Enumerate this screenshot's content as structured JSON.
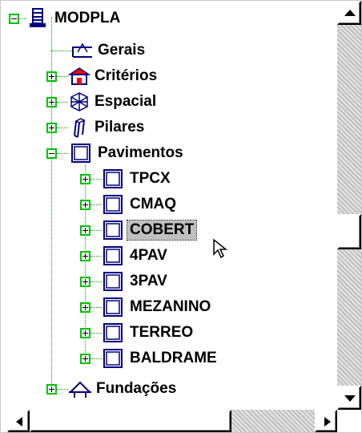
{
  "tree": {
    "nodes": [
      {
        "id": "root",
        "label": "MODPLA",
        "icon": "building-icon",
        "expander": "minus"
      },
      {
        "id": "gerais",
        "label": "Gerais",
        "icon": "beam-icon",
        "expander": "none"
      },
      {
        "id": "criterios",
        "label": "Critérios",
        "icon": "criteria-icon",
        "expander": "plus"
      },
      {
        "id": "espacial",
        "label": "Espacial",
        "icon": "spatial-frame-icon",
        "expander": "plus"
      },
      {
        "id": "pilares",
        "label": "Pilares",
        "icon": "column-icon",
        "expander": "plus"
      },
      {
        "id": "pavimentos",
        "label": "Pavimentos",
        "icon": "floor-icon",
        "expander": "minus"
      },
      {
        "id": "tpcx",
        "label": "TPCX",
        "icon": "floor-icon",
        "expander": "plus"
      },
      {
        "id": "cmaq",
        "label": "CMAQ",
        "icon": "floor-icon",
        "expander": "plus"
      },
      {
        "id": "cobert",
        "label": "COBERT",
        "icon": "floor-icon",
        "expander": "plus",
        "selected": true
      },
      {
        "id": "4pav",
        "label": "4PAV",
        "icon": "floor-icon",
        "expander": "plus"
      },
      {
        "id": "3pav",
        "label": "3PAV",
        "icon": "floor-icon",
        "expander": "plus"
      },
      {
        "id": "mezanino",
        "label": "MEZANINO",
        "icon": "floor-icon",
        "expander": "plus"
      },
      {
        "id": "terreo",
        "label": "TERREO",
        "icon": "floor-icon",
        "expander": "plus"
      },
      {
        "id": "baldrame",
        "label": "BALDRAME",
        "icon": "floor-icon",
        "expander": "plus"
      },
      {
        "id": "fundacoes",
        "label": "Fundações",
        "icon": "foundation-icon",
        "expander": "plus"
      }
    ]
  },
  "scrollbars": {
    "vertical": {
      "up_icon": "arrow-up-icon",
      "down_icon": "arrow-down-icon",
      "position": 0.55
    },
    "horizontal": {
      "left_icon": "arrow-left-icon",
      "right_icon": "arrow-right-icon",
      "position": 0.0
    }
  },
  "colors": {
    "tree_lines": "#00a000",
    "expander_border": "#00c000",
    "selection_bg": "#c0c0c0"
  }
}
